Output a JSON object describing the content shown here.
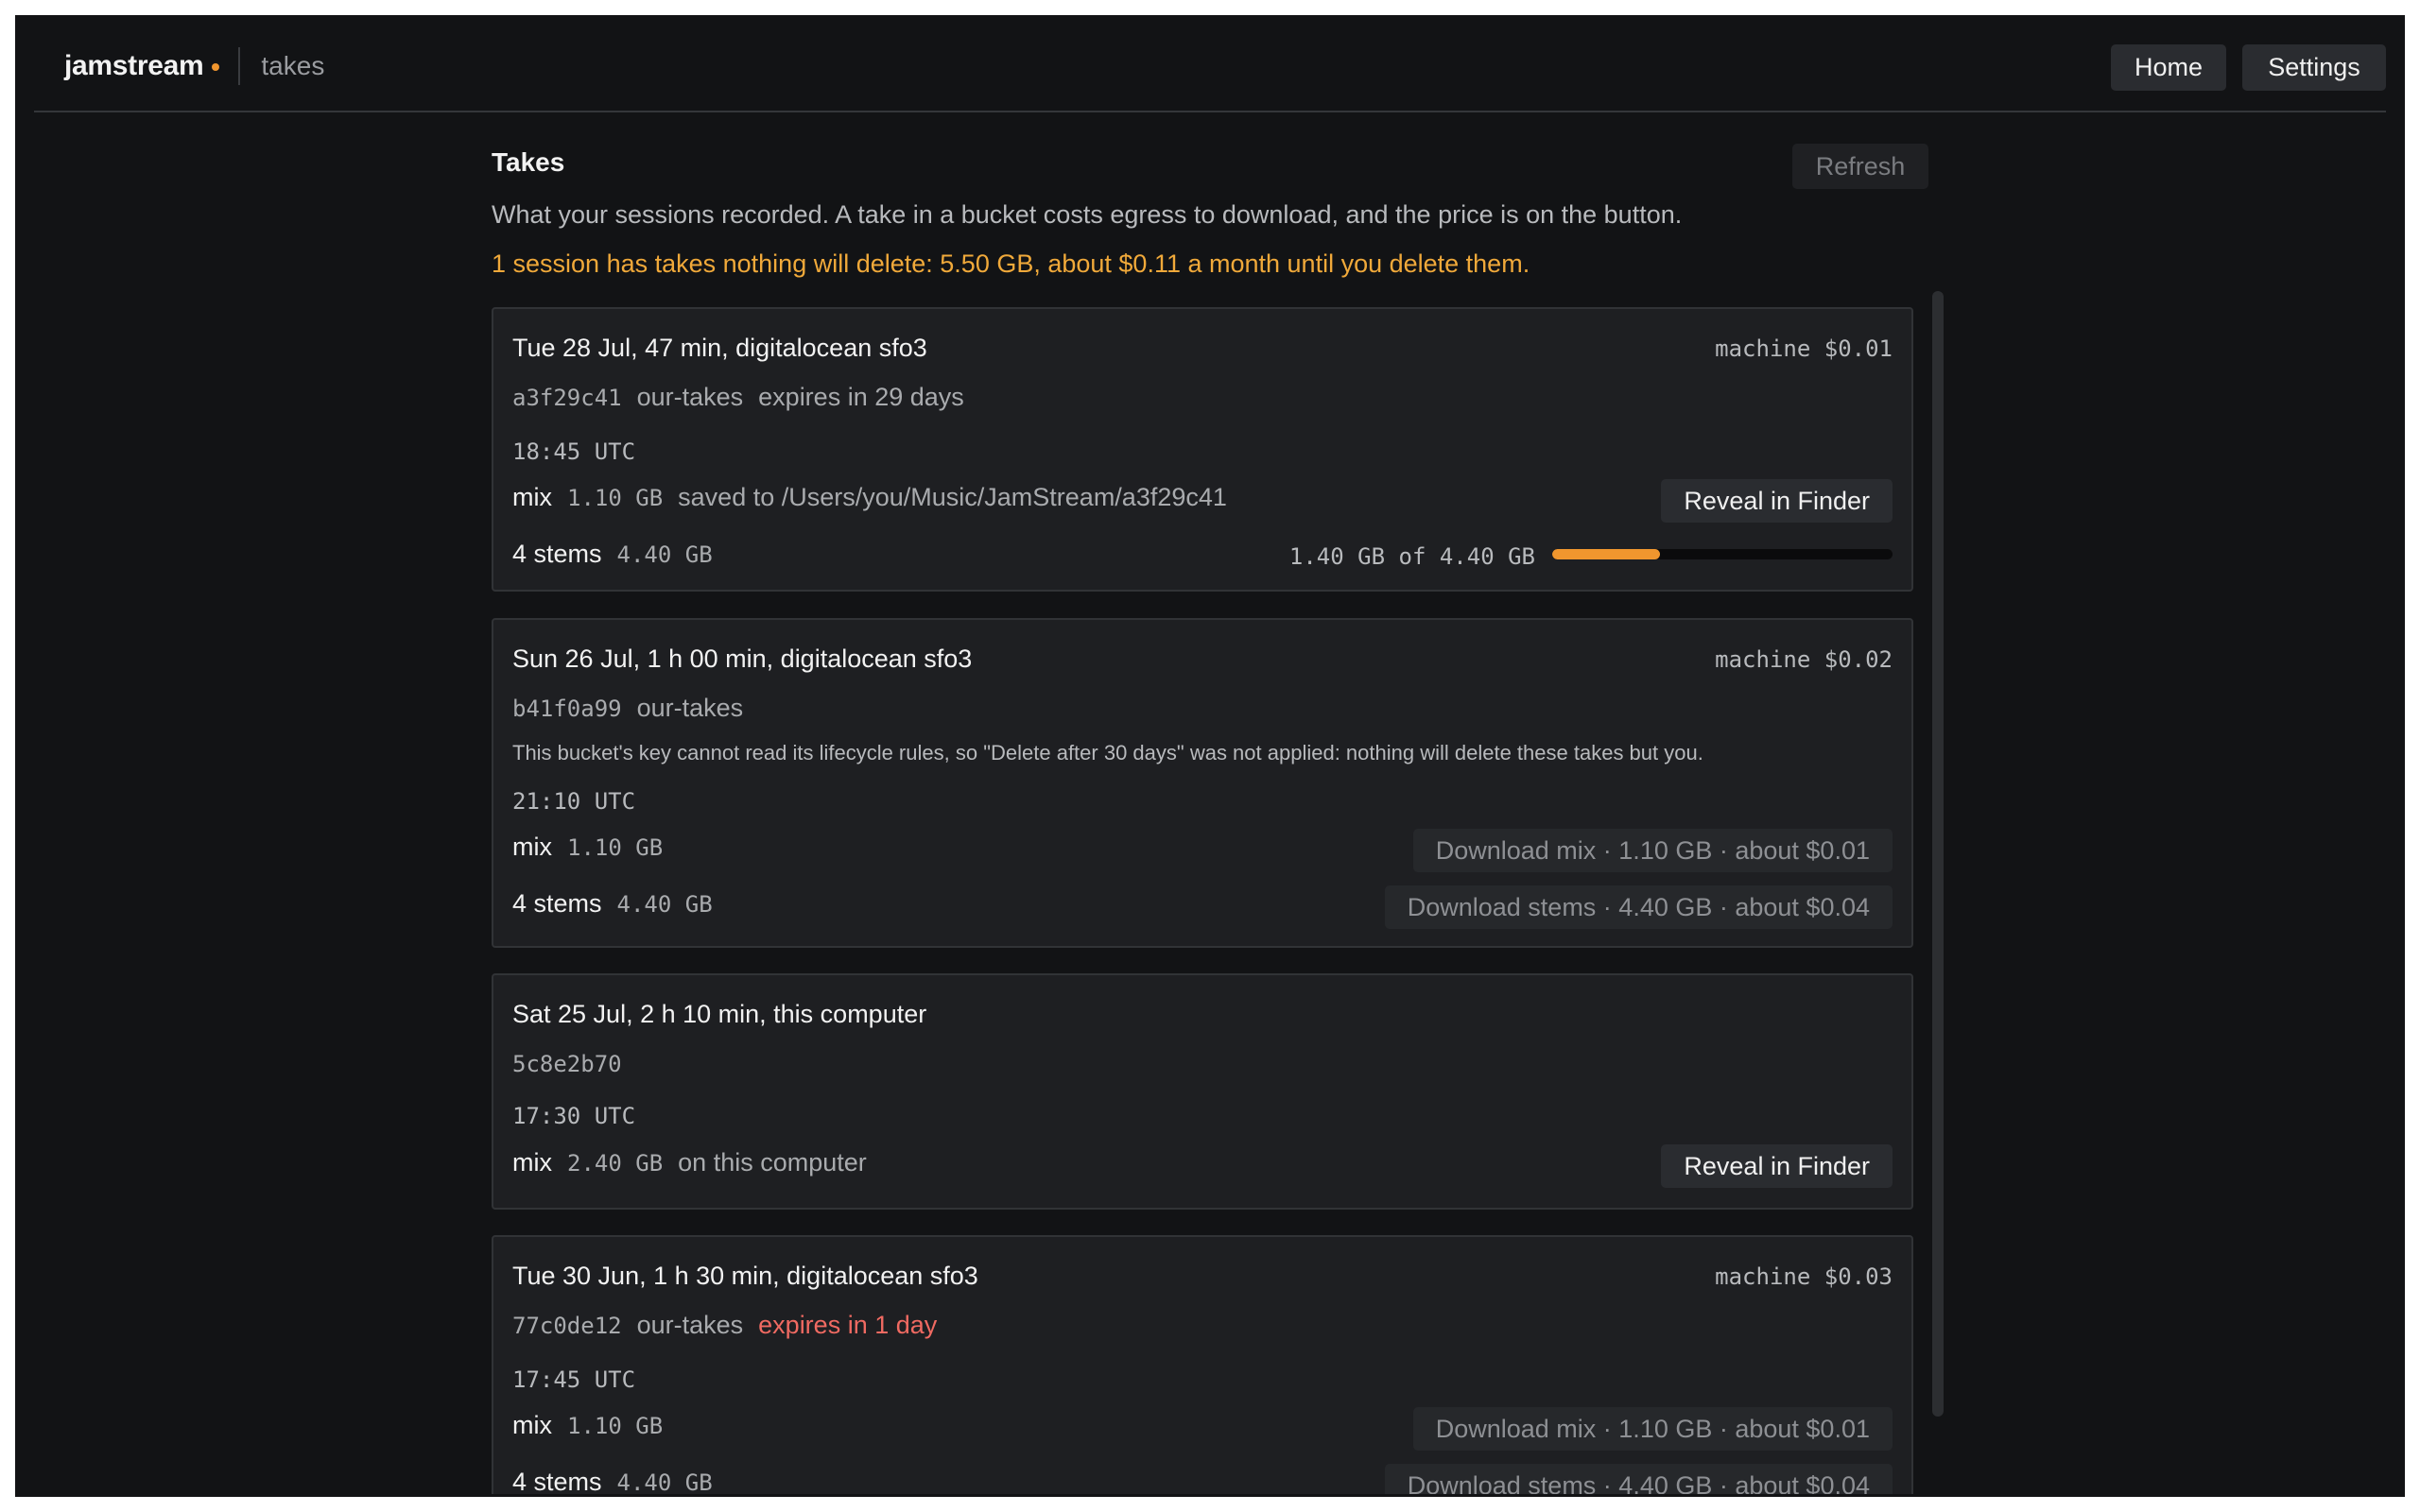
{
  "app": {
    "brand": "jamstream",
    "page": "takes",
    "nav": {
      "home": "Home",
      "settings": "Settings"
    },
    "accent": "#f0962e"
  },
  "takes": {
    "heading": "Takes",
    "refresh_label": "Refresh",
    "intro": "What your sessions recorded. A take in a bucket costs egress to download, and the price is on the button.",
    "warning": "1 session has takes nothing will delete: 5.50 GB, about $0.11 a month until you delete them.",
    "warning_color": "#f0a93a"
  },
  "sessions": [
    {
      "title": "Tue 28 Jul, 47 min, digitalocean sfo3",
      "machine": "machine $0.01",
      "id": "a3f29c41",
      "bucket": "our-takes",
      "expires": "expires in 29 days",
      "time": "18:45 UTC",
      "mix": {
        "label": "mix",
        "size": "1.10 GB",
        "note": "saved to /Users/you/Music/JamStream/a3f29c41",
        "button": "Reveal in Finder"
      },
      "stems": {
        "label": "4 stems",
        "size": "4.40 GB",
        "progress_text": "1.40 GB of 4.40 GB",
        "progress": 0.318
      }
    },
    {
      "title": "Sun 26 Jul, 1 h 00 min, digitalocean sfo3",
      "machine": "machine $0.02",
      "id": "b41f0a99",
      "bucket": "our-takes",
      "note": "This bucket's key cannot read its lifecycle rules, so \"Delete after 30 days\" was not applied: nothing will delete these takes but you.",
      "time": "21:10 UTC",
      "mix": {
        "label": "mix",
        "size": "1.10 GB",
        "button": "Download mix · 1.10 GB · about $0.01"
      },
      "stems": {
        "label": "4 stems",
        "size": "4.40 GB",
        "button": "Download stems · 4.40 GB · about $0.04"
      }
    },
    {
      "title": "Sat 25 Jul, 2 h 10 min, this computer",
      "id": "5c8e2b70",
      "time": "17:30 UTC",
      "mix": {
        "label": "mix",
        "size": "2.40 GB",
        "note": "on this computer",
        "button": "Reveal in Finder"
      }
    },
    {
      "title": "Tue 30 Jun, 1 h 30 min, digitalocean sfo3",
      "machine": "machine $0.03",
      "id": "77c0de12",
      "bucket": "our-takes",
      "expires": "expires in 1 day",
      "expires_color": "#f06a62",
      "time": "17:45 UTC",
      "mix": {
        "label": "mix",
        "size": "1.10 GB",
        "button": "Download mix · 1.10 GB · about $0.01"
      },
      "stems": {
        "label": "4 stems",
        "size": "4.40 GB",
        "button": "Download stems · 4.40 GB · about $0.04"
      }
    }
  ]
}
